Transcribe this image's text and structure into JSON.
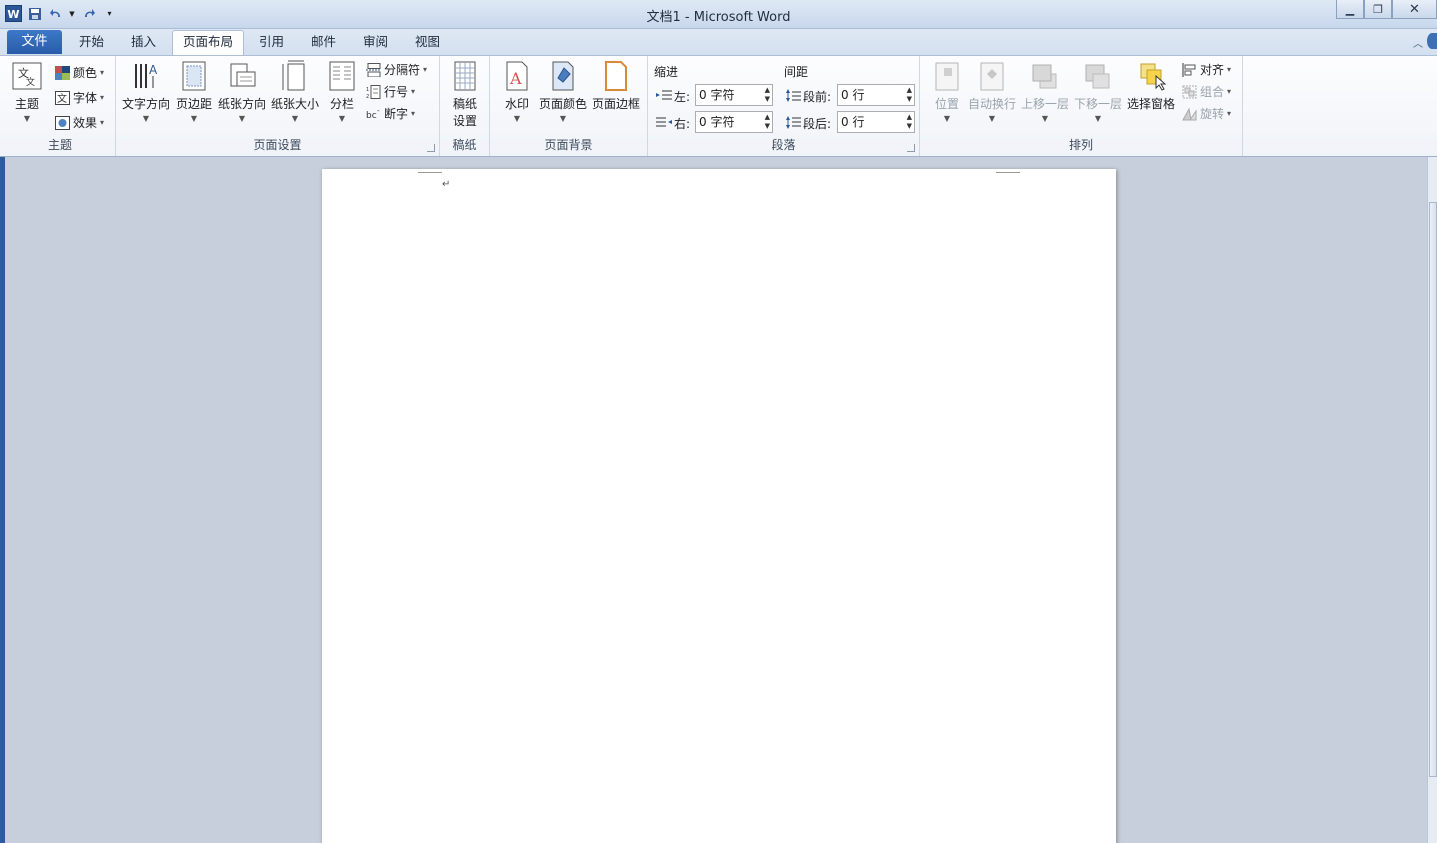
{
  "window": {
    "title": "文档1 - Microsoft Word",
    "app_icon": "W",
    "controls": [
      "minimize",
      "maximize",
      "close"
    ]
  },
  "tabs": {
    "file": "文件",
    "items": [
      "开始",
      "插入",
      "页面布局",
      "引用",
      "邮件",
      "审阅",
      "视图"
    ],
    "active": "页面布局"
  },
  "ribbon": {
    "theme": {
      "label": "主题",
      "theme_button": "主题",
      "colors": "颜色",
      "fonts": "字体",
      "effects": "效果"
    },
    "page_setup": {
      "label": "页面设置",
      "text_direction": "文字方向",
      "margins": "页边距",
      "orientation": "纸张方向",
      "size": "纸张大小",
      "columns": "分栏",
      "breaks": "分隔符",
      "line_numbers": "行号",
      "hyphenation": "断字"
    },
    "draft_paper": {
      "label": "稿纸",
      "settings_line1": "稿纸",
      "settings_line2": "设置"
    },
    "page_background": {
      "label": "页面背景",
      "watermark": "水印",
      "page_color": "页面颜色",
      "page_borders": "页面边框"
    },
    "paragraph": {
      "label": "段落",
      "indent_title": "缩进",
      "spacing_title": "间距",
      "indent_left_label": "左:",
      "indent_left_value": "0 字符",
      "indent_right_label": "右:",
      "indent_right_value": "0 字符",
      "spacing_before_label": "段前:",
      "spacing_before_value": "0 行",
      "spacing_after_label": "段后:",
      "spacing_after_value": "0 行"
    },
    "arrange": {
      "label": "排列",
      "position": "位置",
      "wrap_text": "自动换行",
      "bring_forward": "上移一层",
      "send_backward": "下移一层",
      "selection_pane": "选择窗格",
      "align": "对齐",
      "group": "组合",
      "rotate": "旋转"
    }
  },
  "document": {
    "paragraph_mark": "↵"
  },
  "colors": {
    "file_tab": "#2a5ca8",
    "title_bar": "#c7d7ec",
    "workspace": "#c6cfdb"
  }
}
